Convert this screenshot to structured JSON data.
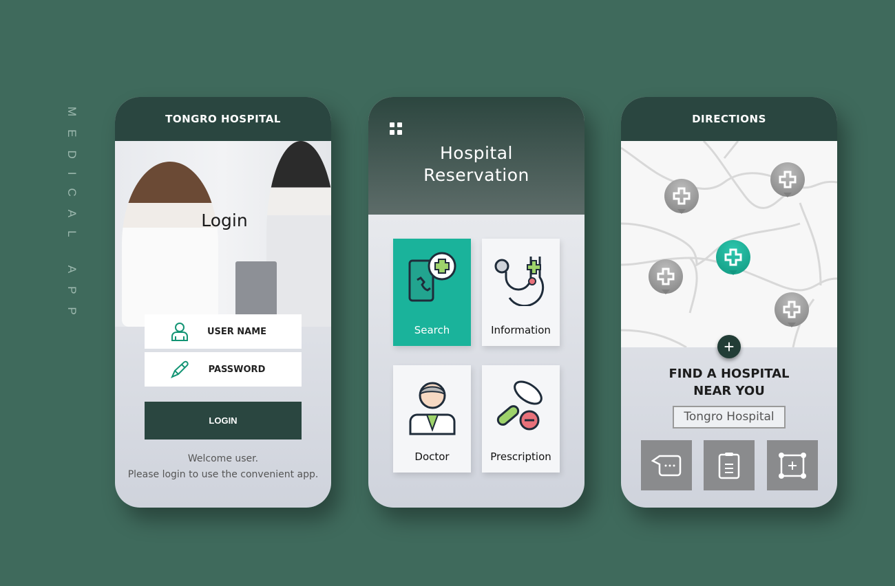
{
  "side_label": "MEDICAL APP",
  "login_screen": {
    "title": "TONGRO HOSPITAL",
    "heading": "Login",
    "username_label": "USER NAME",
    "password_label": "PASSWORD",
    "login_button": "LOGIN",
    "welcome": "Welcome user.",
    "instruction": "Please login to use the convenient app."
  },
  "reservation_screen": {
    "title_line1": "Hospital",
    "title_line2": "Reservation",
    "tiles": [
      {
        "label": "Search",
        "icon": "phone-medical-icon",
        "active": true
      },
      {
        "label": "Information",
        "icon": "stethoscope-icon"
      },
      {
        "label": "Doctor",
        "icon": "doctor-icon"
      },
      {
        "label": "Prescription",
        "icon": "pills-icon"
      }
    ]
  },
  "directions_screen": {
    "title": "DIRECTIONS",
    "find_line1": "FIND A HOSPITAL",
    "find_line2": "NEAR YOU",
    "hospital_name": "Tongro Hospital",
    "actions": [
      "chat-icon",
      "clipboard-icon",
      "add-area-icon"
    ]
  },
  "colors": {
    "background": "#3f6a5c",
    "header": "#2a4640",
    "accent": "#1ab39b",
    "action_gray": "#8a8b8d"
  }
}
